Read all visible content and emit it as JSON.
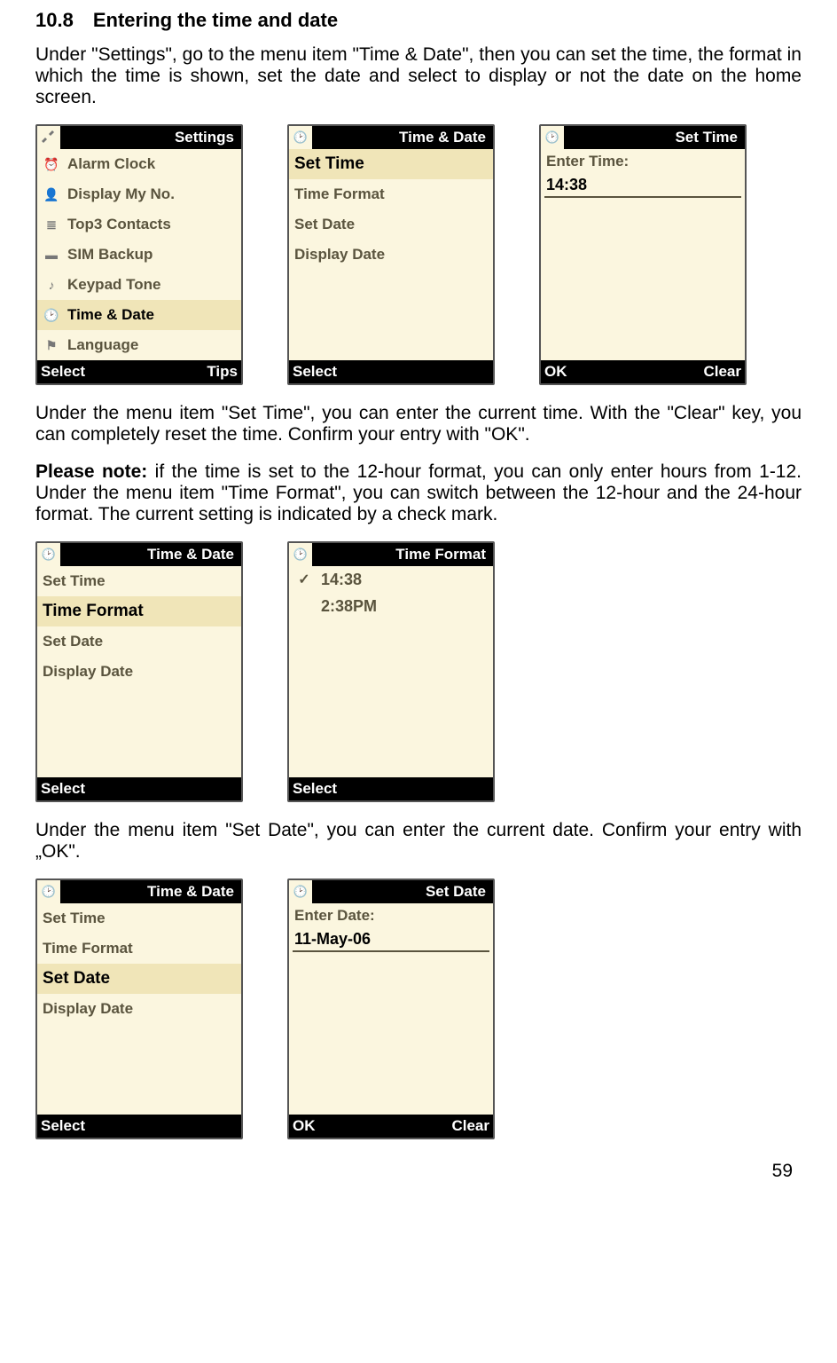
{
  "heading_num": "10.8",
  "heading_text": "Entering the time and date",
  "para1": "Under \"Settings\", go to the menu item \"Time & Date\", then you can set the time, the format in which the time is shown, set the date and select to display or not the date on the home screen.",
  "para2": "Under the menu item \"Set Time\", you can enter the current time. With the \"Clear\" key, you can completely reset the time. Confirm your entry with \"OK\".",
  "para3_bold": "Please note:",
  "para3_rest": " if the time is set to the 12-hour format, you can only enter hours from 1-12. Under the menu item \"Time Format\", you can switch between the 12-hour and the 24-hour format. The current setting is indicated by a check mark.",
  "para4": "Under the menu item \"Set Date\", you can enter the current date. Confirm your entry with „OK\".",
  "page_number": "59",
  "row1": {
    "settings": {
      "title": "Settings",
      "soft_left": "Select",
      "soft_right": "Tips",
      "items": [
        "Alarm Clock",
        "Display My No.",
        "Top3 Contacts",
        "SIM Backup",
        "Keypad Tone",
        "Time & Date",
        "Language"
      ],
      "selected_index": 5
    },
    "timedate": {
      "title": "Time & Date",
      "soft_left": "Select",
      "soft_right": "",
      "items": [
        "Set Time",
        "Time Format",
        "Set Date",
        "Display Date"
      ],
      "selected_index": 0
    },
    "settime": {
      "title": "Set Time",
      "soft_left": "OK",
      "soft_right": "Clear",
      "label": "Enter Time:",
      "value": "14:38"
    }
  },
  "row2": {
    "timedate": {
      "title": "Time & Date",
      "soft_left": "Select",
      "soft_right": "",
      "items": [
        "Set Time",
        "Time Format",
        "Set Date",
        "Display Date"
      ],
      "selected_index": 1
    },
    "timeformat": {
      "title": "Time Format",
      "soft_left": "Select",
      "soft_right": "",
      "options": [
        "14:38",
        "2:38PM"
      ],
      "checked_index": 0
    }
  },
  "row3": {
    "timedate": {
      "title": "Time & Date",
      "soft_left": "Select",
      "soft_right": "",
      "items": [
        "Set Time",
        "Time Format",
        "Set Date",
        "Display Date"
      ],
      "selected_index": 2
    },
    "setdate": {
      "title": "Set Date",
      "soft_left": "OK",
      "soft_right": "Clear",
      "label": "Enter Date:",
      "value": "11-May-06"
    }
  }
}
